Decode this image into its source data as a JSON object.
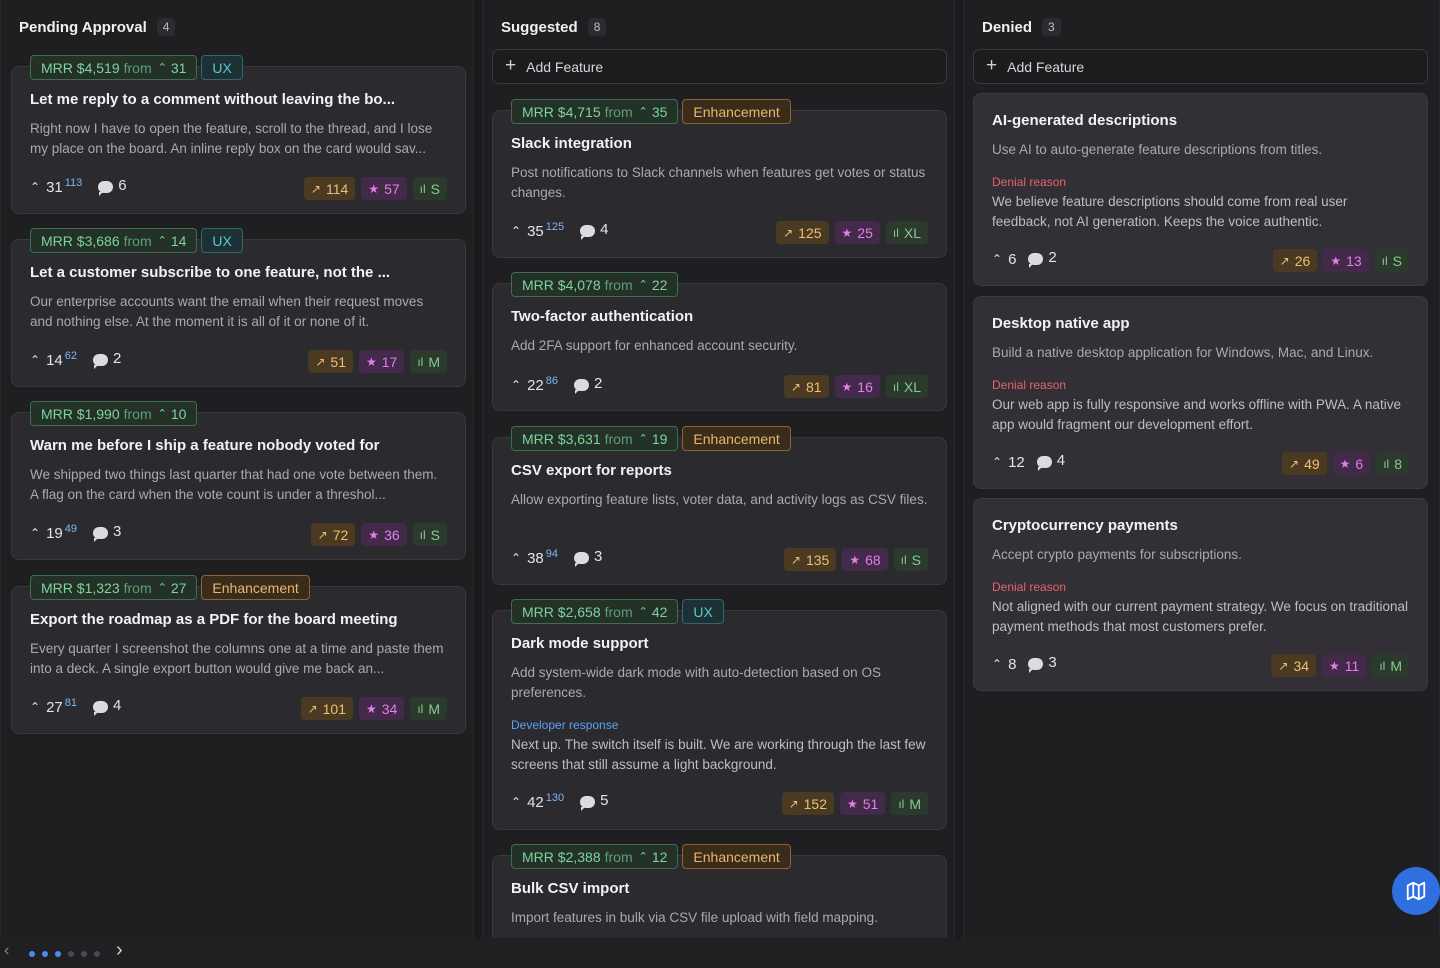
{
  "columns": {
    "pending": {
      "title": "Pending Approval",
      "count": "4"
    },
    "suggested": {
      "title": "Suggested",
      "count": "8",
      "add_label": "Add Feature"
    },
    "denied": {
      "title": "Denied",
      "count": "3",
      "add_label": "Add Feature"
    }
  },
  "labels": {
    "mrr_prefix": "MRR",
    "from": "from",
    "denial": "Denial reason",
    "developer": "Developer response"
  },
  "pending": [
    {
      "mrr": "$4,519",
      "from": "31",
      "tag": "UX",
      "title": "Let me reply to a comment without leaving the bo...",
      "desc": "Right now I have to open the feature, scroll to the thread, and I lose my place on the board. An inline reply box on the card would sav...",
      "votes": "31",
      "vote_sup": "113",
      "comments": "6",
      "trend": "114",
      "stars": "57",
      "size": "S"
    },
    {
      "mrr": "$3,686",
      "from": "14",
      "tag": "UX",
      "title": "Let a customer subscribe to one feature, not the ...",
      "desc": "Our enterprise accounts want the email when their request moves and nothing else. At the moment it is all of it or none of it.",
      "votes": "14",
      "vote_sup": "62",
      "comments": "2",
      "trend": "51",
      "stars": "17",
      "size": "M"
    },
    {
      "mrr": "$1,990",
      "from": "10",
      "tag": "",
      "title": "Warn me before I ship a feature nobody voted for",
      "desc": "We shipped two things last quarter that had one vote between them. A flag on the card when the vote count is under a threshol...",
      "votes": "19",
      "vote_sup": "49",
      "comments": "3",
      "trend": "72",
      "stars": "36",
      "size": "S"
    },
    {
      "mrr": "$1,323",
      "from": "27",
      "tag": "Enhancement",
      "title": "Export the roadmap as a PDF for the board meeting",
      "desc": "Every quarter I screenshot the columns one at a time and paste them into a deck. A single export button would give me back an...",
      "votes": "27",
      "vote_sup": "81",
      "comments": "4",
      "trend": "101",
      "stars": "34",
      "size": "M"
    }
  ],
  "suggested": [
    {
      "mrr": "$4,715",
      "from": "35",
      "tag": "Enhancement",
      "title": "Slack integration",
      "desc": "Post notifications to Slack channels when features get votes or status changes.",
      "votes": "35",
      "vote_sup": "125",
      "comments": "4",
      "trend": "125",
      "stars": "25",
      "size": "XL"
    },
    {
      "mrr": "$4,078",
      "from": "22",
      "tag": "",
      "title": "Two-factor authentication",
      "desc": "Add 2FA support for enhanced account security.",
      "votes": "22",
      "vote_sup": "86",
      "comments": "2",
      "trend": "81",
      "stars": "16",
      "size": "XL"
    },
    {
      "mrr": "$3,631",
      "from": "19",
      "tag": "Enhancement",
      "title": "CSV export for reports",
      "desc": "Allow exporting feature lists, voter data, and activity logs as CSV files.",
      "votes": "38",
      "vote_sup": "94",
      "comments": "3",
      "trend": "135",
      "stars": "68",
      "size": "S"
    },
    {
      "mrr": "$2,658",
      "from": "42",
      "tag": "UX",
      "title": "Dark mode support",
      "desc": "Add system-wide dark mode with auto-detection based on OS preferences.",
      "dev_response": "Next up. The switch itself is built. We are working through the last few screens that still assume a light background.",
      "votes": "42",
      "vote_sup": "130",
      "comments": "5",
      "trend": "152",
      "stars": "51",
      "size": "M"
    },
    {
      "mrr": "$2,388",
      "from": "12",
      "tag": "Enhancement",
      "title": "Bulk CSV import",
      "desc": "Import features in bulk via CSV file upload with field mapping."
    }
  ],
  "denied": [
    {
      "title": "AI-generated descriptions",
      "desc": "Use AI to auto-generate feature descriptions from titles.",
      "reason": "We believe feature descriptions should come from real user feedback, not AI generation. Keeps the voice authentic.",
      "votes": "6",
      "comments": "2",
      "trend": "26",
      "stars": "13",
      "size": "S"
    },
    {
      "title": "Desktop native app",
      "desc": "Build a native desktop application for Windows, Mac, and Linux.",
      "reason": "Our web app is fully responsive and works offline with PWA. A native app would fragment our development effort.",
      "votes": "12",
      "comments": "4",
      "trend": "49",
      "stars": "6",
      "size": "8"
    },
    {
      "title": "Cryptocurrency payments",
      "desc": "Accept crypto payments for subscriptions.",
      "reason": "Not aligned with our current payment strategy. We focus on traditional payment methods that most customers prefer.",
      "votes": "8",
      "comments": "3",
      "trend": "34",
      "stars": "11",
      "size": "M"
    }
  ],
  "pager": {
    "pages": 6,
    "active": [
      0,
      1,
      2
    ]
  },
  "colors": {
    "accent": "#2f6fe0",
    "dot_active": "#4a8cf0",
    "dot_inactive": "#4a4a50"
  },
  "icons": {
    "vote": "chevron-up-icon",
    "comments": "comment-icon",
    "trend": "trending-up-icon",
    "star": "star-icon",
    "size": "bar-chart-icon",
    "fab": "map-icon"
  }
}
